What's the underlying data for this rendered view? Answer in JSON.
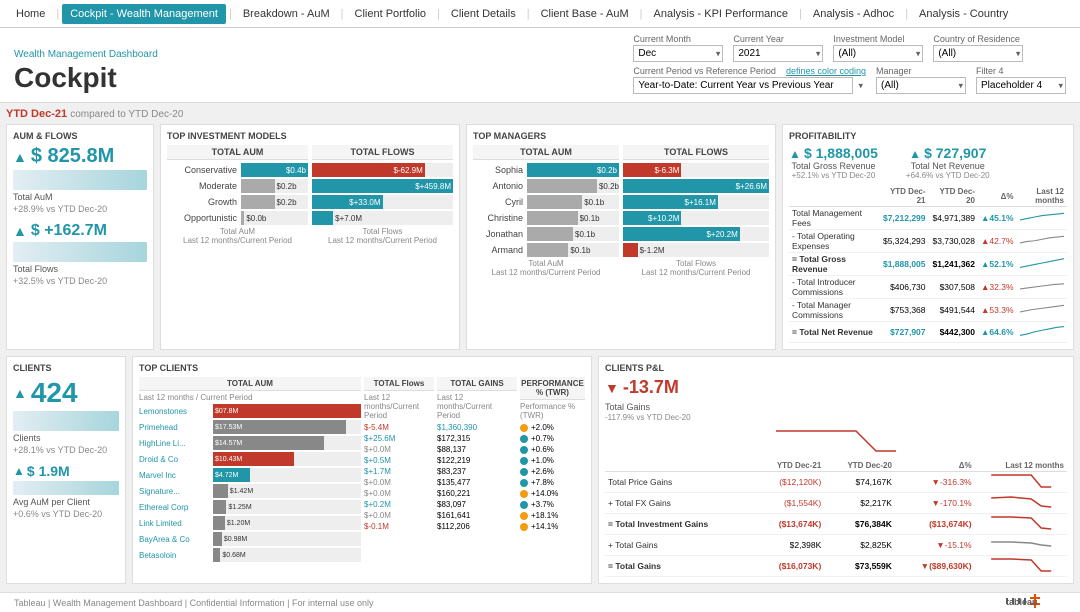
{
  "nav": {
    "items": [
      "Home",
      "Cockpit - Wealth Management",
      "Breakdown - AuM",
      "Client Portfolio",
      "Client Details",
      "Client Base - AuM",
      "Analysis - KPI Performance",
      "Analysis - Adhoc",
      "Analysis - Country"
    ],
    "active": "Cockpit - Wealth Management"
  },
  "header": {
    "sub_title": "Wealth Management Dashboard",
    "main_title": "Cockpit",
    "filters": {
      "current_month_label": "Current Month",
      "current_month_value": "Dec",
      "current_year_label": "Current Year",
      "current_year_value": "2021",
      "investment_model_label": "Investment Model",
      "investment_model_value": "(All)",
      "country_label": "Country of Residence",
      "country_value": "(All)",
      "period_label": "Current Period vs Reference Period",
      "period_value": "Year-to-Date: Current Year vs Previous Year",
      "color_coding": "defines color coding",
      "manager_label": "Manager",
      "manager_value": "(All)",
      "filter4_label": "Filter 4",
      "filter4_value": "Placeholder 4"
    }
  },
  "ytd_label": "YTD Dec-21",
  "compared_label": "compared to YTD Dec-20",
  "sections": {
    "aum_flows": {
      "title": "AuM & FLOWS",
      "total_aum_value": "$ 825.8M",
      "total_aum_label": "Total AuM",
      "total_aum_change": "+28.9% vs YTD Dec-20",
      "total_flows_value": "$ +162.7M",
      "total_flows_label": "Total Flows",
      "total_flows_change": "+32.5% vs YTD Dec-20"
    },
    "top_investment": {
      "title": "TOP INVESTMENT MODELS",
      "total_aum_title": "TOTAL AUM",
      "total_flows_title": "TOTAL FLOWS",
      "rows": [
        {
          "label": "Conservative",
          "aum_val": "$0.4b",
          "flows_val": "$-62.9M"
        },
        {
          "label": "Moderate",
          "aum_val": "$0.2b",
          "flows_val": "$+459.8M"
        },
        {
          "label": "Growth",
          "aum_val": "$0.2b",
          "flows_val": "$+33.0M"
        },
        {
          "label": "Opportunistic",
          "aum_val": "$0.0b",
          "flows_val": "$+7.0M"
        }
      ]
    },
    "top_managers": {
      "title": "TOP MANAGERS",
      "total_aum_title": "TOTAL AUM",
      "total_flows_title": "TOTAL FLOWS",
      "rows": [
        {
          "label": "Sophia",
          "aum_val": "$0.2b",
          "flows_val": "$-6.3M"
        },
        {
          "label": "Antonio",
          "aum_val": "$0.2b",
          "flows_val": "$+26.6M"
        },
        {
          "label": "Cyril",
          "aum_val": "$0.1b",
          "flows_val": "$+16.1M"
        },
        {
          "label": "Christine",
          "aum_val": "$0.1b",
          "flows_val": "$+10.2M"
        },
        {
          "label": "Jonathan",
          "aum_val": "$0.1b",
          "flows_val": "$+20.2M"
        },
        {
          "label": "Armand",
          "aum_val": "$0.1b",
          "flows_val": "$-1.2M"
        }
      ]
    },
    "profitability": {
      "title": "PROFITABILITY",
      "gross_revenue_value": "$ 1,888,005",
      "gross_revenue_label": "Total Gross Revenue",
      "gross_revenue_change": "+52.1% vs YTD Dec-20",
      "net_revenue_value": "$ 727,907",
      "net_revenue_label": "Total Net Revenue",
      "net_revenue_change": "+64.6% vs YTD Dec-20",
      "table_headers": [
        "YTD Dec-21",
        "YTD Dec-20",
        "Δ%",
        "Last 12 months"
      ],
      "rows": [
        {
          "label": "Total Management Fees",
          "v1": "$7,212,299",
          "v2": "$4,971,389",
          "delta": "▲45.1%",
          "delta_color": "blue"
        },
        {
          "label": "- Total Operating Expenses",
          "v1": "$5,324,293",
          "v2": "$3,730,028",
          "delta": "▲42.7%",
          "delta_color": "red"
        },
        {
          "label": "= Total Gross Revenue",
          "v1": "$1,888,005",
          "v2": "$1,241,362",
          "delta": "▲52.1%",
          "delta_color": "blue"
        },
        {
          "label": "- Total Introducer Commissions",
          "v1": "$406,730",
          "v2": "$307,508",
          "delta": "▲32.3%",
          "delta_color": "red"
        },
        {
          "label": "- Total Manager Commissions",
          "v1": "$753,368",
          "v2": "$491,544",
          "delta": "▲53.3%",
          "delta_color": "red"
        },
        {
          "label": "= Total Net Revenue",
          "v1": "$727,907",
          "v2": "$442,300",
          "delta": "▲64.6%",
          "delta_color": "blue"
        }
      ]
    },
    "clients": {
      "title": "CLIENTS",
      "count": "424",
      "count_label": "Clients",
      "count_change": "+28.1% vs YTD Dec-20",
      "avg_aum": "$ 1.9M",
      "avg_aum_label": "Avg AuM per Client",
      "avg_aum_change": "+0.6% vs YTD Dec-20"
    },
    "top_clients": {
      "title": "TOP CLIENTS",
      "total_aum_title": "TOTAL AUM",
      "total_flows_title": "TOTAL Flows",
      "total_gains_title": "TOTAL GAINS",
      "perf_title": "PERFORMANCE % (TWR)",
      "rows": [
        {
          "name": "Lemonstones",
          "aum": "$07.8M",
          "flows": "$-5.4M",
          "gains": "$1,360,390",
          "perf": "+2.0%",
          "dot": "orange"
        },
        {
          "name": "Primehead",
          "aum": "$17.53M",
          "flows": "$+25.6M",
          "gains": "$172,315",
          "perf": "+0.7%",
          "dot": "blue"
        },
        {
          "name": "HighLine Lim...",
          "aum": "$14.57M",
          "flows": "$+0.0M",
          "gains": "$88,137",
          "perf": "+0.6%",
          "dot": "blue"
        },
        {
          "name": "Droid & Co",
          "aum": "$10.43M",
          "flows": "$+0.5M",
          "gains": "$122,219",
          "perf": "+1.0%",
          "dot": "blue"
        },
        {
          "name": "Marvel Inc",
          "aum": "$4.72M",
          "flows": "$+1.7M",
          "gains": "$83,237",
          "perf": "+2.6%",
          "dot": "blue"
        },
        {
          "name": "Signature Ac...",
          "aum": "$1.42M",
          "flows": "$+0.0M",
          "gains": "$135,477",
          "perf": "+7.8%",
          "dot": "blue"
        },
        {
          "name": "Ethereal Corp",
          "aum": "$1.25M",
          "flows": "$+0.0M",
          "gains": "$160,221",
          "perf": "+14.0%",
          "dot": "orange"
        },
        {
          "name": "Link Limited",
          "aum": "$1.20M",
          "flows": "$+0.2M",
          "gains": "$83,097",
          "perf": "+3.7%",
          "dot": "blue"
        },
        {
          "name": "BayArea & Co",
          "aum": "$0.98M",
          "flows": "$+0.0M",
          "gains": "$161,641",
          "perf": "+18.1%",
          "dot": "orange"
        },
        {
          "name": "Betasoloin",
          "aum": "$0.68M",
          "flows": "$-0.1M",
          "gains": "$112,206",
          "perf": "+14.1%",
          "dot": "orange"
        }
      ]
    },
    "clients_pnl": {
      "title": "CLIENTS P&L",
      "total_gains_value": "-13.7M",
      "total_gains_label": "Total Gains",
      "total_gains_change": "-117.9% vs YTD Dec-20",
      "table_headers": [
        "YTD Dec-21",
        "YTD Dec-20",
        "Δ%",
        "Last 12 months"
      ],
      "rows": [
        {
          "label": "Total Price Gains",
          "v1": "($12,120K)",
          "v2": "$74,167K",
          "delta": "▼-316.3%",
          "delta_color": "red"
        },
        {
          "label": "+ Total FX Gains",
          "v1": "($1,554K)",
          "v2": "$2,217K",
          "delta": "▼-170.1%",
          "delta_color": "red"
        },
        {
          "label": "= Total Investment Gains",
          "v1": "($13,674K)",
          "v2": "$76,384K",
          "delta": "($13,674K)",
          "delta_color": "red"
        },
        {
          "label": "+ Total Gains",
          "v1": "$2,398K",
          "v2": "$2,825K",
          "delta": "▼-15.1%",
          "delta_color": "red"
        },
        {
          "label": "= Total Gains",
          "v1": "($16,073K)",
          "v2": "$73,559K",
          "delta": "▼($89,630K)",
          "delta_color": "red"
        }
      ]
    }
  },
  "footer": {
    "text": "Tableau | Wealth Management Dashboard | Confidential Information | For internal use only",
    "logo": "tableau"
  }
}
